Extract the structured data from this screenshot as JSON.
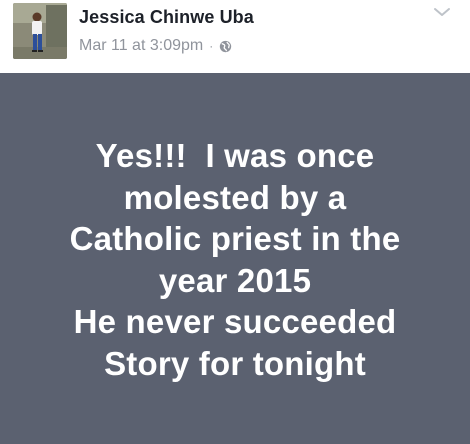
{
  "post": {
    "author": {
      "name": "Jessica Chinwe Uba"
    },
    "timestamp": "Mar 11 at 3:09pm",
    "separator": "·",
    "privacy_icon": "globe-icon",
    "menu_icon": "chevron-down-icon",
    "background_color": "#5b6170",
    "text_lines": [
      "Yes!!!  I was once",
      "molested by a",
      "Catholic priest in the",
      "year 2015",
      "He never succeeded",
      "Story for tonight"
    ]
  }
}
